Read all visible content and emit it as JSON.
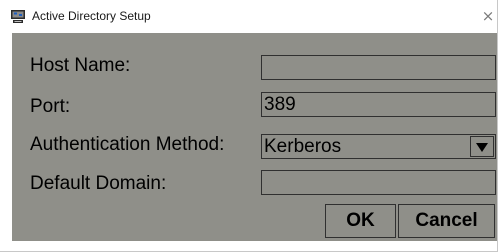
{
  "window": {
    "title": "Active Directory Setup",
    "close_glyph": "×",
    "icon": "network-computer-icon"
  },
  "form": {
    "host_name": {
      "label": "Host Name:",
      "value": ""
    },
    "port": {
      "label": "Port:",
      "value": "389"
    },
    "auth_method": {
      "label": "Authentication Method:",
      "value": "Kerberos",
      "icon": "dropdown-arrow-icon"
    },
    "default_domain": {
      "label": "Default Domain:",
      "value": ""
    }
  },
  "buttons": {
    "ok": "OK",
    "cancel": "Cancel"
  },
  "colors": {
    "background": "#8f8f89",
    "border": "#303030",
    "titlebar": "#ffffff"
  }
}
